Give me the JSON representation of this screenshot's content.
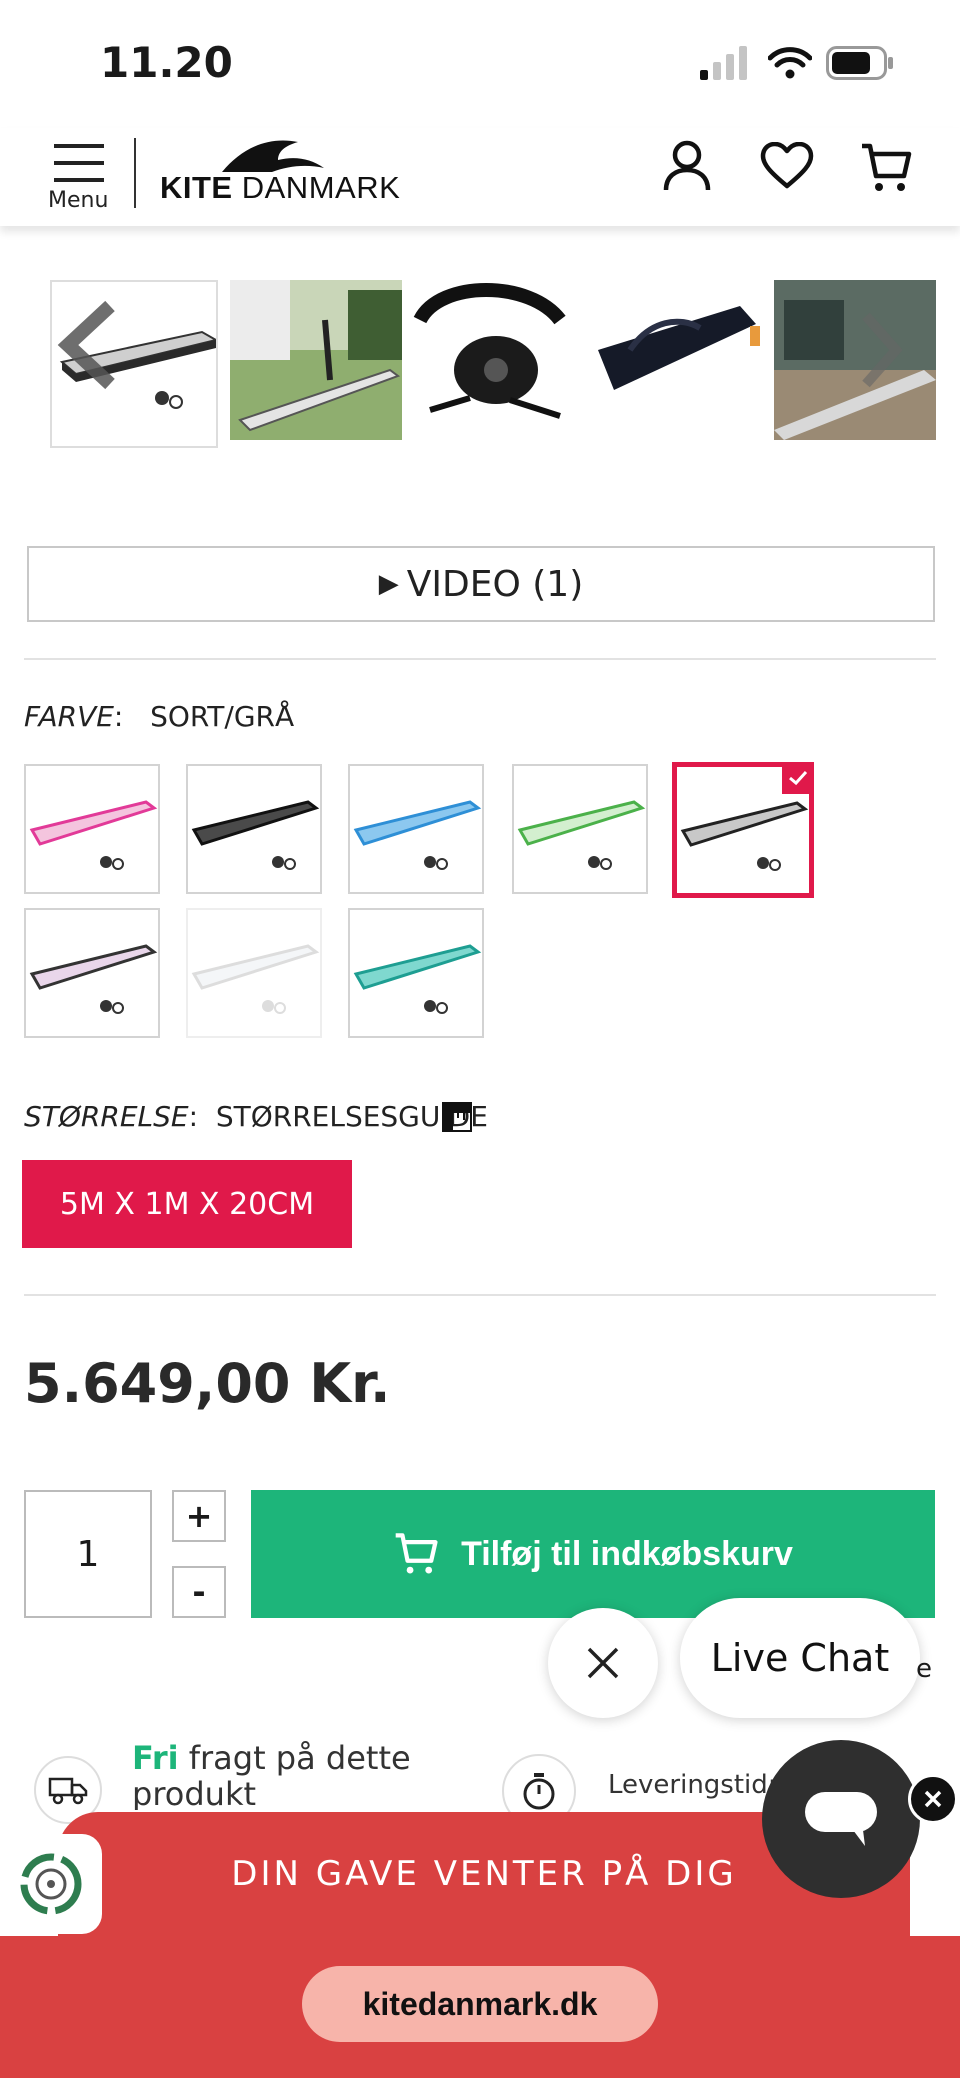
{
  "status": {
    "time": "11.20"
  },
  "header": {
    "menu_label": "Menu",
    "logo_bold": "KITE",
    "logo_rest": " DANMARK"
  },
  "video": {
    "label": "VIDEO (1)"
  },
  "color": {
    "label": "FARVE",
    "value": "SORT/GRÅ"
  },
  "size": {
    "label": "STØRRELSE",
    "guide": "STØRRELSESGUIDE",
    "selected": "5M X 1M X 20CM"
  },
  "price": "5.649,00 Kr.",
  "quantity": {
    "value": "1",
    "plus": "+",
    "minus": "-"
  },
  "cart": {
    "label": "Tilføj til indkøbskurv"
  },
  "chat": {
    "label": "Live Chat"
  },
  "shipping": {
    "highlight": "Fri",
    "text": " fragt på dette",
    "text2": "produkt",
    "delivery": "Leveringstid:"
  },
  "banner": {
    "gift": "DIN GAVE VENTER PÅ DIG"
  },
  "browser": {
    "url": "kitedanmark.dk"
  },
  "colors": {
    "accent": "#e0194a",
    "green": "#1db57a",
    "banner": "#d94141"
  }
}
